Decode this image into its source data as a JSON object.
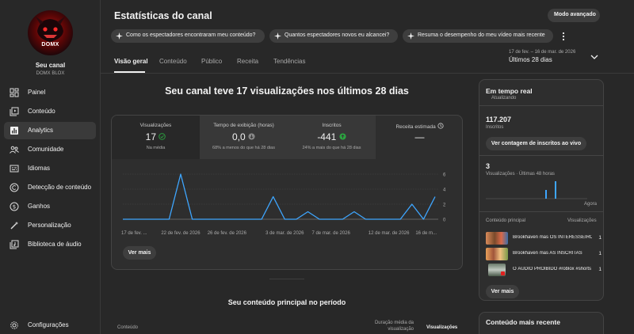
{
  "app": {
    "title": "Estatísticas do canal",
    "advanced_mode": "Modo avançado"
  },
  "channel": {
    "avatar_text": "DOMX",
    "name": "Seu canal",
    "handle": "DOMX BLOX"
  },
  "sidebar": {
    "items": [
      {
        "label": "Painel",
        "icon": "dashboard-icon"
      },
      {
        "label": "Conteúdo",
        "icon": "content-icon"
      },
      {
        "label": "Analytics",
        "icon": "analytics-icon",
        "active": true
      },
      {
        "label": "Comunidade",
        "icon": "community-icon"
      },
      {
        "label": "Idiomas",
        "icon": "subtitles-icon"
      },
      {
        "label": "Detecção de conteúdo",
        "icon": "copyright-icon"
      },
      {
        "label": "Ganhos",
        "icon": "earn-icon"
      },
      {
        "label": "Personalização",
        "icon": "customization-icon"
      },
      {
        "label": "Biblioteca de áudio",
        "icon": "audio-library-icon"
      }
    ],
    "settings_label": "Configurações"
  },
  "prompts": [
    "Como os espectadores encontraram meu conteúdo?",
    "Quantos espectadores novos eu alcancei?",
    "Resuma o desempenho do meu vídeo mais recente"
  ],
  "tabs": [
    "Visão geral",
    "Conteúdo",
    "Público",
    "Receita",
    "Tendências"
  ],
  "date": {
    "range": "17 de fev. – 16 de mar. de 2026",
    "label": "Últimos 28 dias"
  },
  "headline": "Seu canal teve 17 visualizações nos últimos 28 dias",
  "metrics": [
    {
      "label": "Visualizações",
      "value": "17",
      "sub": "Na média",
      "status": "check"
    },
    {
      "label": "Tempo de exibição (horas)",
      "value": "0,0",
      "sub": "68% a menos do que há 28 dias",
      "status": "down"
    },
    {
      "label": "Inscritos",
      "value": "-441",
      "sub": "24% a mais do que há 28 dias",
      "status": "up"
    },
    {
      "label": "Receita estimada",
      "value": "—",
      "sub": "",
      "status": "clock"
    }
  ],
  "chart_data": {
    "type": "line",
    "x": [
      "17 de fev.",
      "18 de fev.",
      "19 de fev.",
      "20 de fev.",
      "21 de fev.",
      "22 de fev.",
      "23 de fev.",
      "24 de fev.",
      "25 de fev.",
      "26 de fev.",
      "27 de fev.",
      "28 de fev.",
      "1 de mar.",
      "2 de mar.",
      "3 de mar.",
      "4 de mar.",
      "5 de mar.",
      "6 de mar.",
      "7 de mar.",
      "8 de mar.",
      "9 de mar.",
      "10 de mar.",
      "11 de mar.",
      "12 de mar.",
      "13 de mar.",
      "14 de mar.",
      "15 de mar.",
      "16 de mar."
    ],
    "series": [
      {
        "values": [
          0,
          0,
          0,
          0,
          0,
          6,
          0,
          0,
          0,
          0,
          0,
          0,
          0,
          3,
          0,
          0,
          1,
          0,
          0,
          0,
          1,
          0,
          0,
          0,
          0,
          2,
          0,
          3
        ]
      }
    ],
    "x_tick_labels": [
      {
        "i": 0,
        "label": "17 de fev. ..."
      },
      {
        "i": 5,
        "label": "22 de fev. de 2026"
      },
      {
        "i": 9,
        "label": "26 de fev. de 2026"
      },
      {
        "i": 14,
        "label": "3 de mar. de 2026"
      },
      {
        "i": 18,
        "label": "7 de mar. de 2026"
      },
      {
        "i": 23,
        "label": "12 de mar. de 2026"
      },
      {
        "i": 27,
        "label": "16 de m..."
      }
    ],
    "yticks": [
      0,
      2,
      4,
      6
    ],
    "ylim": [
      0,
      6
    ],
    "line_color": "#3ea6ff",
    "grid": true
  },
  "see_more": "Ver mais",
  "section": {
    "title": "Seu conteúdo principal no período",
    "col_content": "Conteúdo",
    "col_duration": "Duração média da visualização",
    "col_views": "Visualizações"
  },
  "realtime": {
    "title": "Em tempo real",
    "updating": "Atualizando",
    "subs": "117.207",
    "subs_label": "Inscritos",
    "subs_button": "Ver contagem de inscritos ao vivo",
    "views": "3",
    "views_label": "Visualizações · Últimas 48 horas",
    "now_label": "Agora",
    "views_bars": [
      1,
      2
    ],
    "col_content": "Conteúdo principal",
    "col_views": "Visualizações",
    "videos": [
      {
        "title": "Brookhaven mas OS INTERESSEIROS",
        "views": "1"
      },
      {
        "title": "Brookhaven mas AS INSCRITAS",
        "views": "1"
      },
      {
        "title": "O ÁUDIO PROIBIDO #roblox #shorts",
        "views": "1"
      }
    ],
    "more": "Ver mais"
  },
  "recent": {
    "title": "Conteúdo mais recente"
  },
  "colors": {
    "accent": "#3ea6ff",
    "up": "#2ba640",
    "background": "#282828"
  }
}
